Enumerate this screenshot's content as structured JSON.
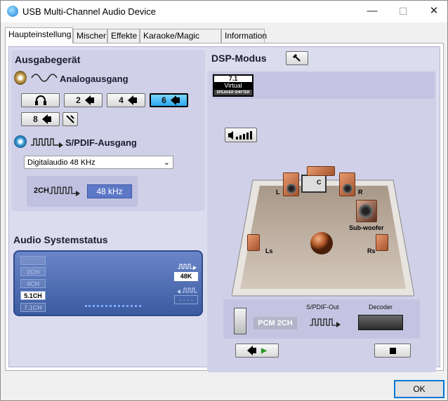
{
  "window": {
    "title": "USB Multi-Channel Audio Device",
    "minimize": "—",
    "maximize": "☐",
    "close": "✕"
  },
  "tabs": [
    "Haupteinstellung",
    "Mischer",
    "Effekte",
    "Karaoke/Magic Voice",
    "Information"
  ],
  "output": {
    "heading": "Ausgabegerät",
    "analog_label": "Analogausgang",
    "speaker_buttons": [
      "2",
      "4",
      "6",
      "8"
    ],
    "selected_speaker": "6",
    "spdif_label": "S/PDIF-Ausgang",
    "spdif_select": "Digitalaudio  48 KHz",
    "spdif_channel": "2CH",
    "spdif_rate": "48 kHz"
  },
  "status": {
    "heading": "Audio Systemstatus",
    "channels": [
      "2CH",
      "4CH",
      "5.1CH",
      "7.1CH"
    ],
    "active_channel": "5.1CH",
    "rate": "48K",
    "input_rate": "- - - -"
  },
  "dsp": {
    "heading": "DSP-Modus",
    "badge_top": "7.1",
    "badge_mid": "Virtual",
    "badge_bottom": "SPEAKER SHIFTER",
    "speakers": {
      "c": "C",
      "l": "L",
      "r": "R",
      "ls": "Ls",
      "rs": "Rs",
      "sub": "Sub-woofer"
    },
    "pcm": "PCM 2CH",
    "spdif_out": "S/PDIF-Out",
    "decoder": "Decoder"
  },
  "ok_label": "OK",
  "colors": {
    "accent": "#2aa6f0",
    "panel": "#dcdcef",
    "status_bg": "#3b5aa0"
  }
}
